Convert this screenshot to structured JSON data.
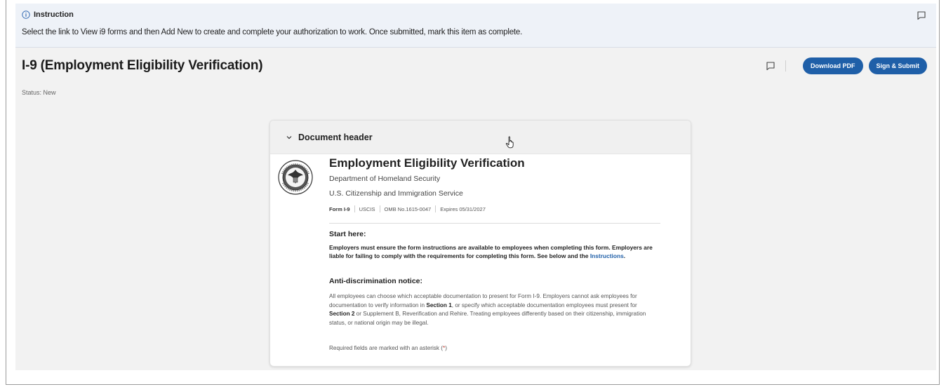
{
  "instruction": {
    "heading": "Instruction",
    "text": "Select the link to View i9 forms and then Add New to create and complete your authorization to work.  Once submitted, mark this item as complete."
  },
  "page": {
    "title": "I-9 (Employment Eligibility Verification)",
    "status": "Status: New",
    "download_label": "Download PDF",
    "submit_label": "Sign & Submit"
  },
  "document": {
    "header_label": "Document header",
    "title": "Employment Eligibility Verification",
    "dept": "Department of Homeland Security",
    "agency": "U.S. Citizenship and Immigration Service",
    "meta": {
      "form": "Form I-9",
      "agency_code": "USCIS",
      "omb": "OMB No.1615-0047",
      "expires": "Expires 05/31/2027"
    },
    "start_heading": "Start here:",
    "employers_text": "Employers must ensure the form instructions are available to employees when completing this form. Employers are liable for failing to comply with the requirements for completing this form. See below and the ",
    "instructions_link": "Instructions",
    "instructions_after": ".",
    "anti_heading": "Anti-discrimination notice:",
    "anti_part1": "All employees can choose which acceptable documentation to present for Form I-9. Employers cannot ask employees for documentation to verify information in ",
    "anti_section1": "Section 1",
    "anti_part2": ", or specify which acceptable documentation employees must present for ",
    "anti_section2": "Section 2",
    "anti_part3": " or Supplement B, Reverification and Rehire. Treating employees differently based on their citizenship, immigration status, or national origin may be illegal.",
    "required_text": "Required fields are marked with an asterisk (",
    "required_ast": "*",
    "required_end": ")"
  },
  "colors": {
    "primary": "#1f5fa8",
    "banner_bg": "#eef2f8",
    "main_bg": "#f2f2f2"
  }
}
